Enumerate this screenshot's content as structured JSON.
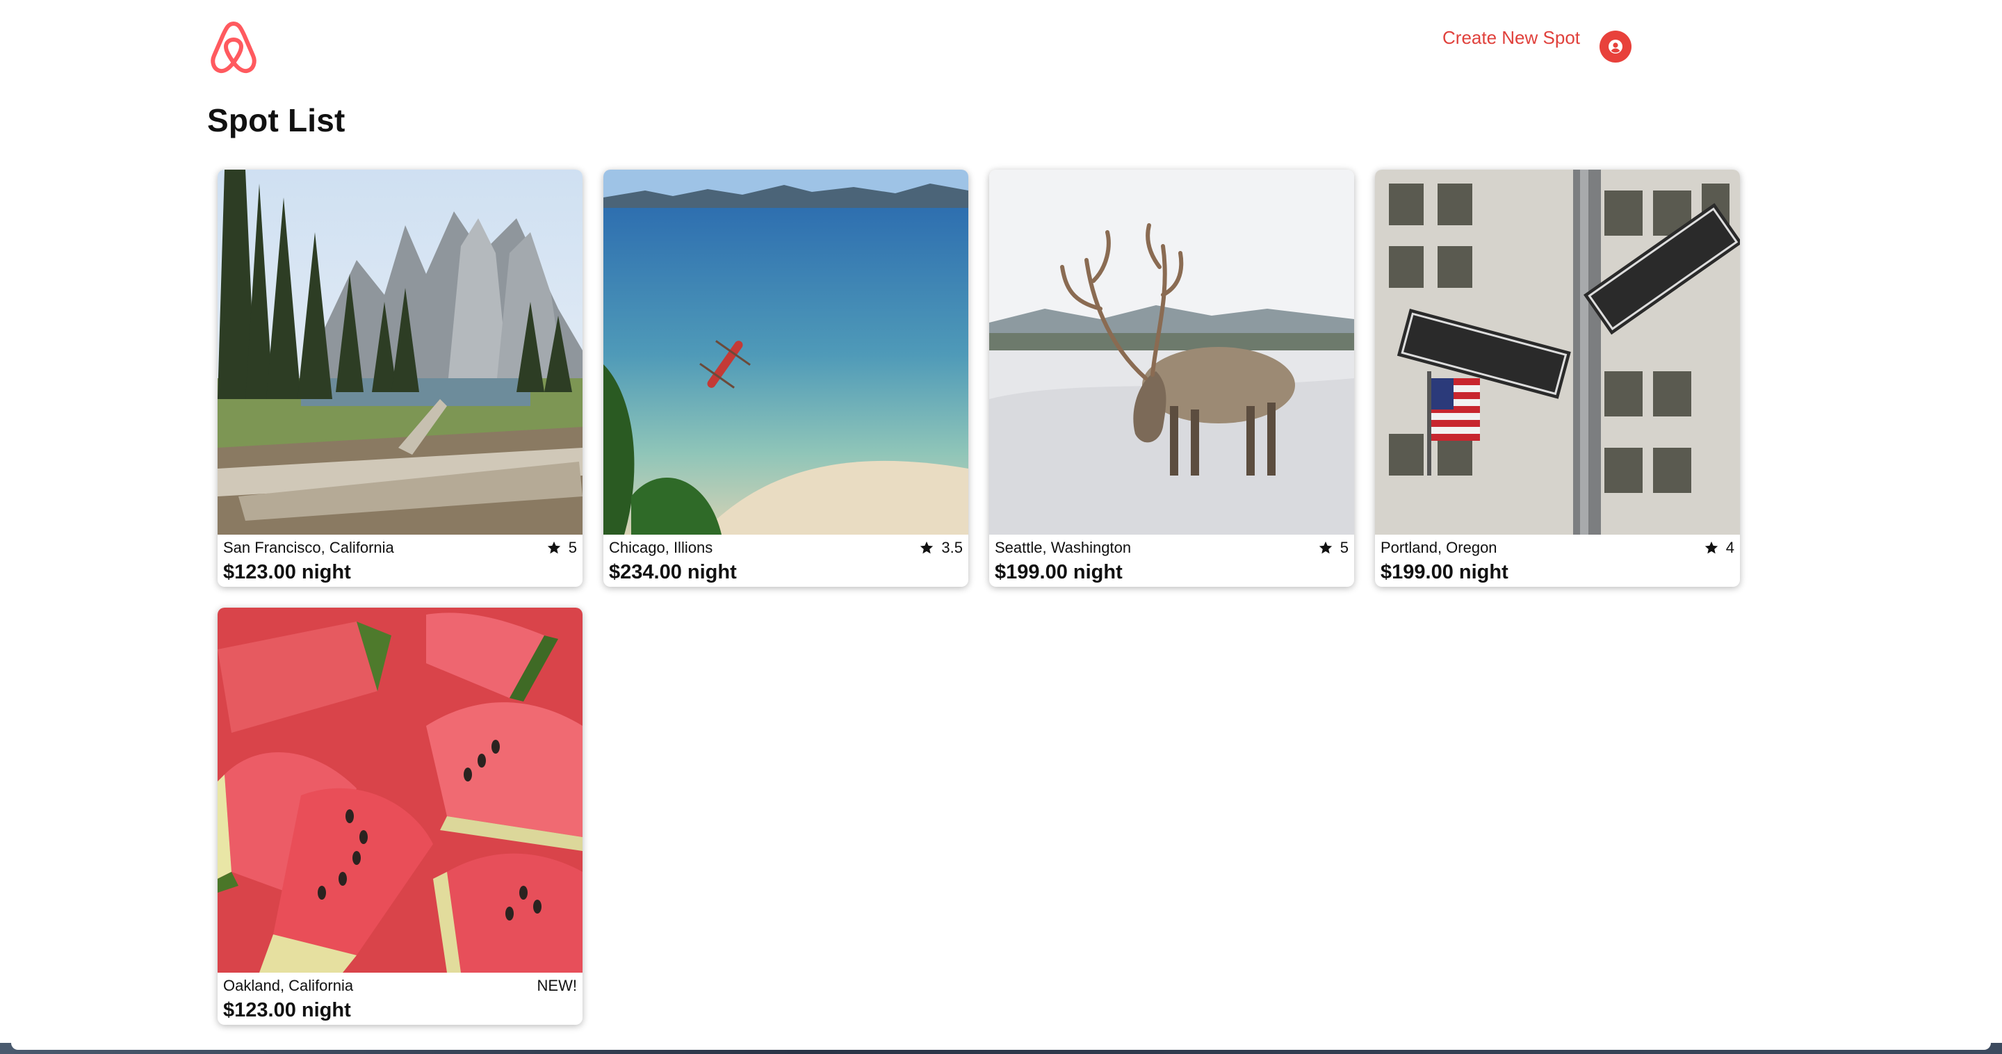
{
  "header": {
    "create_spot_label": "Create New Spot",
    "logo_icon": "airbnb-logo-icon",
    "profile_icon": "user-circle-icon"
  },
  "page": {
    "title": "Spot List"
  },
  "colors": {
    "brand": "#FF5A5F",
    "link": "#E0413C",
    "profile_button": "#E8413B"
  },
  "spots": [
    {
      "location": "San Francisco, California",
      "rating": "5",
      "price": "$123.00 night",
      "image": "mountain-forest-river"
    },
    {
      "location": "Chicago, Illions",
      "rating": "3.5",
      "price": "$234.00 night",
      "image": "tropical-beach-boat"
    },
    {
      "location": "Seattle, Washington",
      "rating": "5",
      "price": "$199.00 night",
      "image": "reindeer-snow"
    },
    {
      "location": "Portland, Oregon",
      "rating": "4",
      "price": "$199.00 night",
      "image": "broadway-morris-street-sign"
    },
    {
      "location": "Oakland, California",
      "rating": "NEW!",
      "price": "$123.00 night",
      "image": "watermelon-slices"
    }
  ]
}
